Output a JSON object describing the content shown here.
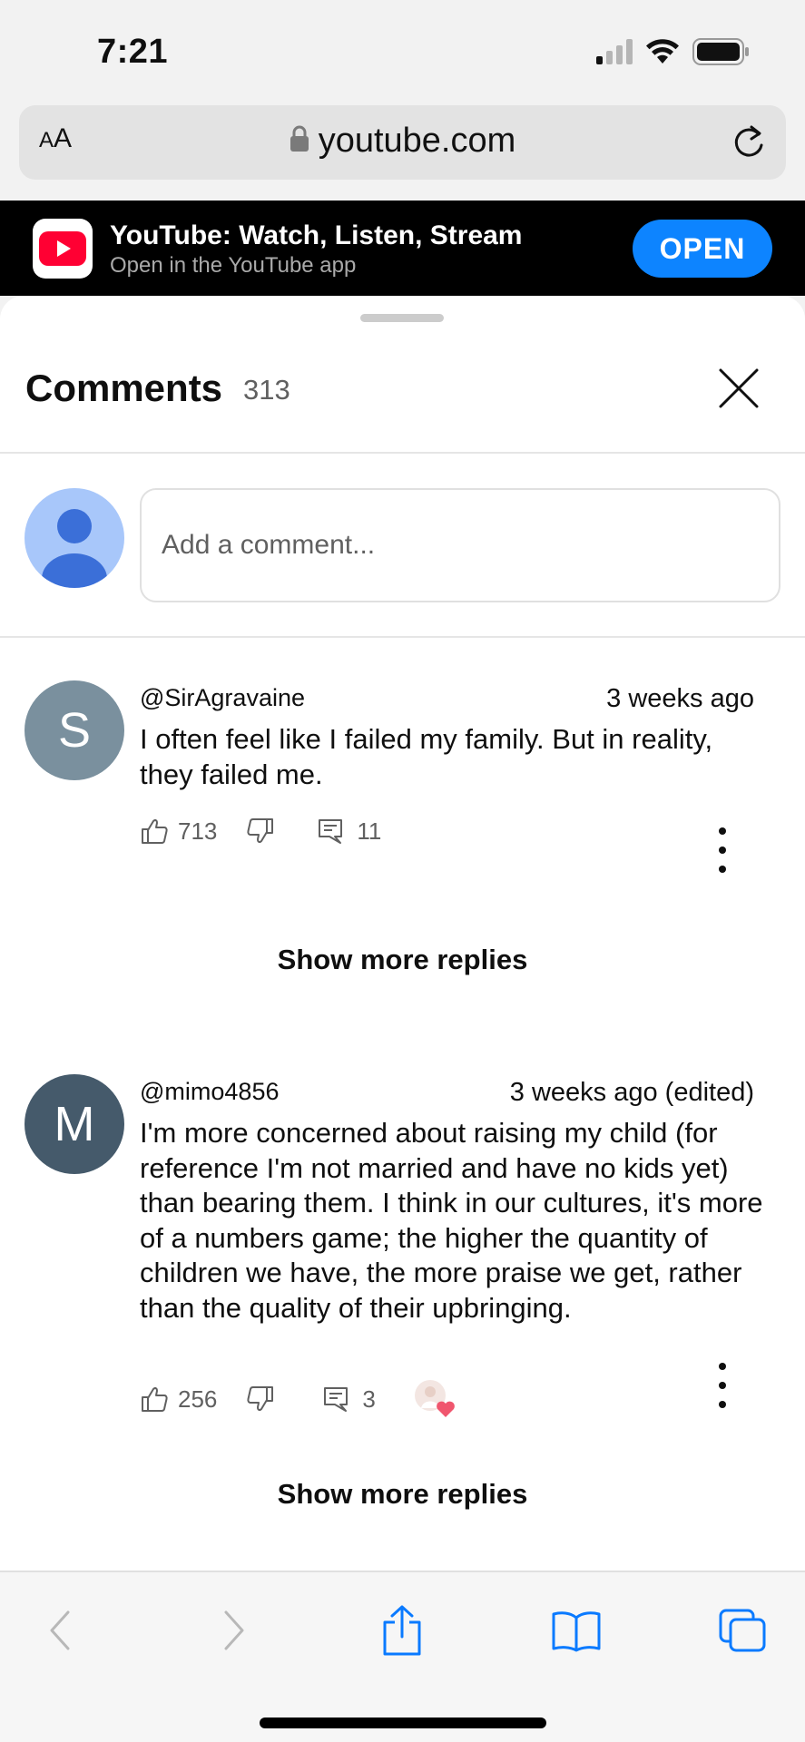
{
  "status_bar": {
    "time": "7:21"
  },
  "browser": {
    "aa_label_small": "A",
    "aa_label_large": "A",
    "url": "youtube.com"
  },
  "app_banner": {
    "title": "YouTube: Watch, Listen, Stream",
    "subtitle": "Open in the YouTube app",
    "open_label": "OPEN"
  },
  "comments_panel": {
    "title": "Comments",
    "count": "313",
    "input_placeholder": "Add a comment..."
  },
  "comments": [
    {
      "avatar_letter": "S",
      "avatar_color": "#7a909e",
      "author": "@SirAgravaine",
      "time": "3 weeks ago",
      "text": "I often feel like I failed my family. But in reality, they failed me.",
      "likes": "713",
      "replies": "11",
      "show_more": "Show more replies"
    },
    {
      "avatar_letter": "M",
      "avatar_color": "#455a6b",
      "author": "@mimo4856",
      "time": "3 weeks ago (edited)",
      "text": "I'm more concerned about raising my child (for reference I'm not married and have no kids yet) than bearing them. I think in our cultures, it's more of a numbers game; the higher the quantity of children we have, the more praise we get, rather than the quality of their upbringing.",
      "likes": "256",
      "replies": "3",
      "show_more": "Show more replies"
    }
  ],
  "colors": {
    "accent_blue": "#0d84ff",
    "youtube_red": "#ff0000",
    "toolbar_blue": "#0a7aff"
  },
  "toolbar_icons": [
    "back-icon",
    "forward-icon",
    "share-icon",
    "bookmarks-icon",
    "tabs-icon"
  ]
}
